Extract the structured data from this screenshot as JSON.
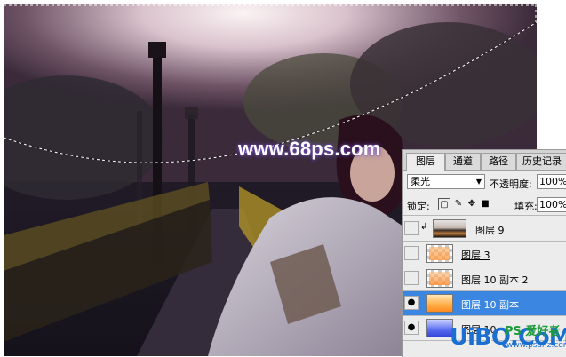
{
  "watermark": "www.68ps.com",
  "panel": {
    "tabs": [
      "图层",
      "通道",
      "路径",
      "历史记录"
    ],
    "blend_mode": "柔光",
    "opacity_label": "不透明度:",
    "opacity_value": "100%",
    "lock_label": "锁定:",
    "fill_label": "填充:",
    "fill_value": "100%",
    "layers": [
      {
        "name": "图层 9",
        "visible": false,
        "selected": false
      },
      {
        "name": "图层 3",
        "visible": false,
        "selected": false
      },
      {
        "name": "图层 10 副本 2",
        "visible": false,
        "selected": false
      },
      {
        "name": "图层 10 副本",
        "visible": true,
        "selected": true
      },
      {
        "name": "图层 10",
        "visible": true,
        "selected": false
      }
    ]
  },
  "badge": {
    "logo": "UiBQ.CoM",
    "chinese": "PS 爱好者",
    "url": "www.psahz.com"
  },
  "colors": {
    "selection": "#3a86e0",
    "watermark_glow": "#7b57d8"
  }
}
